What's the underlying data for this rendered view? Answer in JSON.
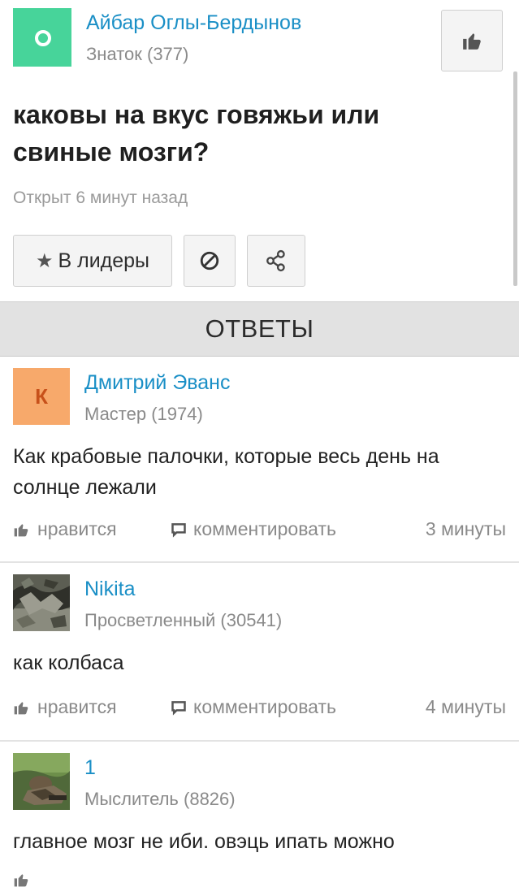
{
  "question": {
    "author": "Айбар Оглы-Бердынов",
    "author_rank": "Знаток (377)",
    "title": "каковы на вкус говяжьи или свиные мозги?",
    "opened": "Открыт 6 минут назад",
    "buttons": {
      "leaders_label": "В лидеры"
    }
  },
  "answers_header": "ОТВЕТЫ",
  "actions": {
    "like_label": "нравится",
    "comment_label": "комментировать"
  },
  "answers": [
    {
      "avatar_letter": "К",
      "name": "Дмитрий Эванс",
      "rank": "Мастер (1974)",
      "text": "Как крабовые палочки, которые весь день на солнце лежали",
      "time": "3 минуты"
    },
    {
      "name": "Nikita",
      "rank": "Просветленный (30541)",
      "text": "как колбаса",
      "time": "4 минуты"
    },
    {
      "name": "1",
      "rank": "Мыслитель (8826)",
      "text": "главное мозг не иби. овэць ипать можно"
    }
  ],
  "colors": {
    "link": "#1a8fc6",
    "question_avatar": "#47d49a",
    "answer_avatar_k": "#f7a96b",
    "muted": "#8a8a8a"
  },
  "icons": {
    "like": "thumbs-up-icon",
    "comment": "comment-icon",
    "block": "block-icon",
    "share": "share-icon",
    "star": "star-icon"
  }
}
